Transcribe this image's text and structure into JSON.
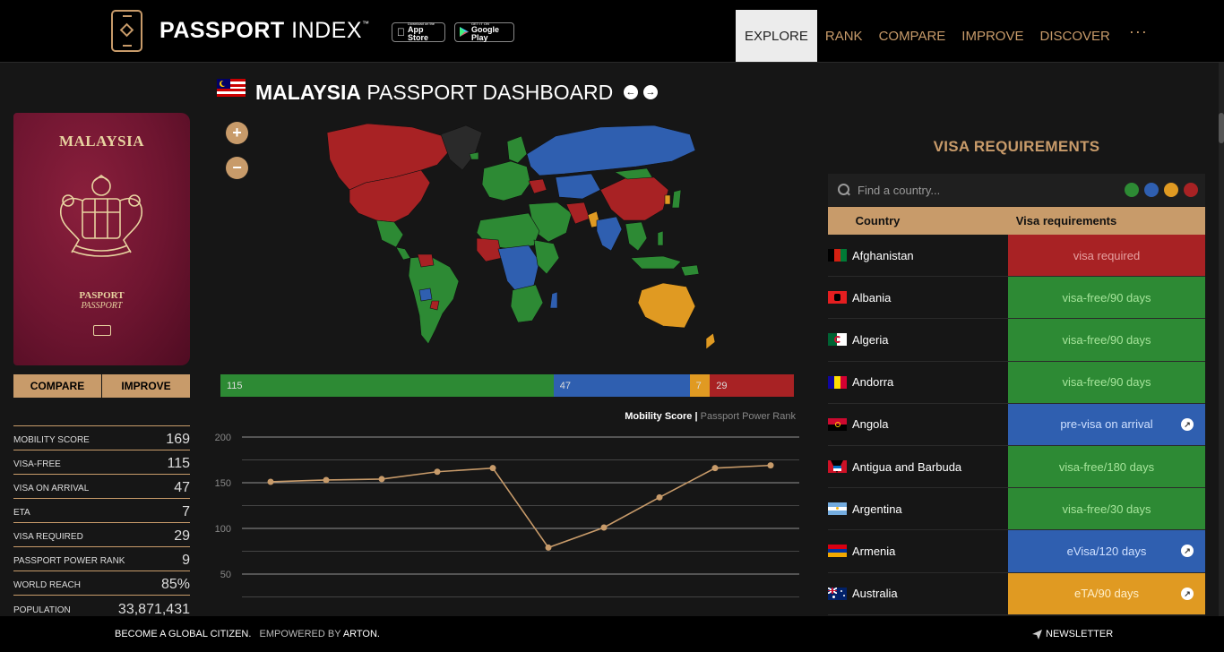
{
  "header": {
    "logo_bold": "PASSPORT",
    "logo_light": "INDEX",
    "logo_tm": "™",
    "app_store_small": "Download on the",
    "app_store_big": "App Store",
    "google_play_small": "GET IT ON",
    "google_play_big": "Google Play",
    "nav": [
      "EXPLORE",
      "RANK",
      "COMPARE",
      "IMPROVE",
      "DISCOVER"
    ],
    "nav_more": "···",
    "active_nav": "EXPLORE"
  },
  "title": {
    "country": "MALAYSIA",
    "suffix": "PASSPORT DASHBOARD",
    "prev_icon": "arrow-left-icon",
    "next_icon": "arrow-right-icon"
  },
  "passport": {
    "country": "MALAYSIA",
    "label1": "PASPORT",
    "label2": "PASSPORT",
    "compare_label": "COMPARE",
    "improve_label": "IMPROVE"
  },
  "stats": [
    {
      "label": "MOBILITY SCORE",
      "value": "169"
    },
    {
      "label": "VISA-FREE",
      "value": "115"
    },
    {
      "label": "VISA ON ARRIVAL",
      "value": "47"
    },
    {
      "label": "ETA",
      "value": "7"
    },
    {
      "label": "VISA REQUIRED",
      "value": "29"
    },
    {
      "label": "PASSPORT POWER RANK",
      "value": "9"
    },
    {
      "label": "WORLD REACH",
      "value": "85%"
    },
    {
      "label": "POPULATION",
      "value": "33,871,431"
    }
  ],
  "map_controls": {
    "zoom_in": "+",
    "zoom_out": "−"
  },
  "distribution": [
    {
      "value": 115,
      "label": "115",
      "color": "#2d8a34"
    },
    {
      "value": 47,
      "label": "47",
      "color": "#2f5fb0"
    },
    {
      "value": 7,
      "label": "7",
      "color": "#e09a22"
    },
    {
      "value": 29,
      "label": "29",
      "color": "#a82224"
    }
  ],
  "colors": {
    "accent": "#c89b6a",
    "visa_free": "#2d8a34",
    "visa_on_arrival": "#2f5fb0",
    "eta": "#e09a22",
    "visa_required": "#a82224"
  },
  "chart_legend": {
    "active": "Mobility Score",
    "separator": "|",
    "inactive": "Passport Power Rank"
  },
  "chart_data": {
    "type": "line",
    "title": "",
    "xlabel": "",
    "ylabel": "",
    "yticks": [
      "200",
      "150",
      "100",
      "50"
    ],
    "ylim": [
      0,
      200
    ],
    "grid": true,
    "series": [
      {
        "name": "Mobility Score",
        "values": [
          151,
          153,
          154,
          162,
          166,
          79,
          101,
          134,
          166,
          169
        ]
      }
    ]
  },
  "visa": {
    "title": "VISA REQUIREMENTS",
    "search_placeholder": "Find a country...",
    "col_country": "Country",
    "col_requirement": "Visa requirements",
    "rows": [
      {
        "country": "Afghanistan",
        "requirement": "visa required",
        "type": "required",
        "link": false
      },
      {
        "country": "Albania",
        "requirement": "visa-free/90 days",
        "type": "free",
        "link": false
      },
      {
        "country": "Algeria",
        "requirement": "visa-free/90 days",
        "type": "free",
        "link": false
      },
      {
        "country": "Andorra",
        "requirement": "visa-free/90 days",
        "type": "free",
        "link": false
      },
      {
        "country": "Angola",
        "requirement": "pre-visa on arrival",
        "type": "arrival",
        "link": true
      },
      {
        "country": "Antigua and Barbuda",
        "requirement": "visa-free/180 days",
        "type": "free",
        "link": false
      },
      {
        "country": "Argentina",
        "requirement": "visa-free/30 days",
        "type": "free",
        "link": false
      },
      {
        "country": "Armenia",
        "requirement": "eVisa/120 days",
        "type": "arrival",
        "link": true
      },
      {
        "country": "Australia",
        "requirement": "eTA/90 days",
        "type": "eta",
        "link": true
      }
    ]
  },
  "footer": {
    "left": "BECOME A GLOBAL CITIZEN.",
    "empowered": "EMPOWERED BY",
    "brand": "ARTON.",
    "newsletter": "NEWSLETTER"
  }
}
